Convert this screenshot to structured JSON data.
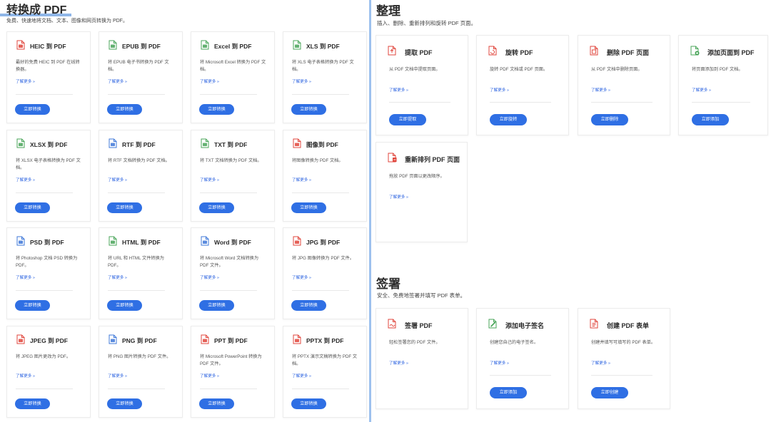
{
  "convert": {
    "title": "转换成 PDF",
    "subtitle": "免费、快速地将文档、文本、图像和网页转换为 PDF。",
    "cards": [
      {
        "title": "HEIC 到 PDF",
        "desc": "最好的免费 HEIC 到 PDF 在线转换器。",
        "link": "了解更多 »",
        "button": "立即转换",
        "color": "#e0463c"
      },
      {
        "title": "EPUB 到 PDF",
        "desc": "将 EPUB 电子书转换为 PDF 文档。",
        "link": "了解更多 »",
        "button": "立即转换",
        "color": "#4aa55a"
      },
      {
        "title": "Excel 到 PDF",
        "desc": "将 Microsoft Excel 转换为 PDF 文档。",
        "link": "了解更多 »",
        "button": "立即转换",
        "color": "#4aa55a"
      },
      {
        "title": "XLS 到 PDF",
        "desc": "将 XLS 电子表格转换为 PDF 文档。",
        "link": "了解更多 »",
        "button": "立即转换",
        "color": "#4aa55a"
      },
      {
        "title": "XLSX 到 PDF",
        "desc": "将 XLSX 电子表格转换为 PDF 文档。",
        "link": "了解更多 »",
        "button": "立即转换",
        "color": "#4aa55a"
      },
      {
        "title": "RTF 到 PDF",
        "desc": "将 RTF 文档转换为 PDF 文档。",
        "link": "了解更多 »",
        "button": "立即转换",
        "color": "#3f78d8"
      },
      {
        "title": "TXT 到 PDF",
        "desc": "将 TXT 文档转换为 PDF 文档。",
        "link": "了解更多 »",
        "button": "立即转换",
        "color": "#4aa55a"
      },
      {
        "title": "图像到 PDF",
        "desc": "将图像转换为 PDF 文档。",
        "link": "了解更多 »",
        "button": "立即转换",
        "color": "#e0463c"
      },
      {
        "title": "PSD 到 PDF",
        "desc": "将 Photoshop 文档 PSD 转换为 PDF。",
        "link": "了解更多 »",
        "button": "立即转换",
        "color": "#3f78d8"
      },
      {
        "title": "HTML 到 PDF",
        "desc": "将 URL 和 HTML 文件转换为 PDF。",
        "link": "了解更多 »",
        "button": "立即转换",
        "color": "#4aa55a"
      },
      {
        "title": "Word 到 PDF",
        "desc": "将 Microsoft Word 文档转换为 PDF 文件。",
        "link": "了解更多 »",
        "button": "立即转换",
        "color": "#3f78d8"
      },
      {
        "title": "JPG 到 PDF",
        "desc": "将 JPG 图像转换为 PDF 文件。",
        "link": "了解更多 »",
        "button": "立即转换",
        "color": "#e0463c"
      },
      {
        "title": "JPEG 到 PDF",
        "desc": "将 JPEG 图片更改为 PDF。",
        "link": "了解更多 »",
        "button": "立即转换",
        "color": "#e0463c"
      },
      {
        "title": "PNG 到 PDF",
        "desc": "将 PNG 图片转换为 PDF 文件。",
        "link": "了解更多 »",
        "button": "立即转换",
        "color": "#3f78d8"
      },
      {
        "title": "PPT 到 PDF",
        "desc": "将 Microsoft PowerPoint 转换为 PDF 文件。",
        "link": "了解更多 »",
        "button": "立即转换",
        "color": "#e0463c"
      },
      {
        "title": "PPTX 到 PDF",
        "desc": "将 PPTX 演示文稿转换为 PDF 文档。",
        "link": "了解更多 »",
        "button": "立即转换",
        "color": "#e0463c"
      }
    ]
  },
  "organize": {
    "title": "整理",
    "subtitle": "插入、删除、重新排列和旋转 PDF 页面。",
    "cards": [
      {
        "title": "提取 PDF",
        "desc": "从 PDF 文档中提取页面。",
        "link": "了解更多 »",
        "button": "立即提取",
        "color": "#e0463c",
        "icon": "extract-icon"
      },
      {
        "title": "旋转 PDF",
        "desc": "旋转 PDF 文档或 PDF 页面。",
        "link": "了解更多 »",
        "button": "立即旋转",
        "color": "#e0463c",
        "icon": "rotate-icon"
      },
      {
        "title": "删除 PDF 页面",
        "desc": "从 PDF 文档中删除页面。",
        "link": "了解更多 »",
        "button": "立即删除",
        "color": "#e0463c",
        "icon": "delete-page-icon"
      },
      {
        "title": "添加页面到 PDF",
        "desc": "将页面添加到 PDF 文档。",
        "link": "了解更多 »",
        "button": "立即添加",
        "color": "#4aa55a",
        "icon": "add-page-icon"
      },
      {
        "title": "重新排列 PDF 页面",
        "desc": "拖放 PDF 页面以更改顺序。",
        "link": "了解更多 »",
        "button": "",
        "color": "#e0463c",
        "icon": "reorder-icon"
      }
    ]
  },
  "sign": {
    "title": "签署",
    "subtitle": "安全、免费地签署并填写 PDF 表单。",
    "cards": [
      {
        "title": "签署 PDF",
        "desc": "轻松签署您的 PDF 文件。",
        "link": "了解更多 »",
        "button": "",
        "color": "#e0463c",
        "icon": "sign-pdf-icon"
      },
      {
        "title": "添加电子签名",
        "desc": "创建您自己的电子签名。",
        "link": "了解更多 »",
        "button": "立即添加",
        "color": "#4aa55a",
        "icon": "e-signature-icon"
      },
      {
        "title": "创建 PDF 表单",
        "desc": "创建并填写可填写的 PDF 表单。",
        "link": "了解更多 »",
        "button": "立即创建",
        "color": "#e0463c",
        "icon": "create-form-icon"
      }
    ]
  }
}
